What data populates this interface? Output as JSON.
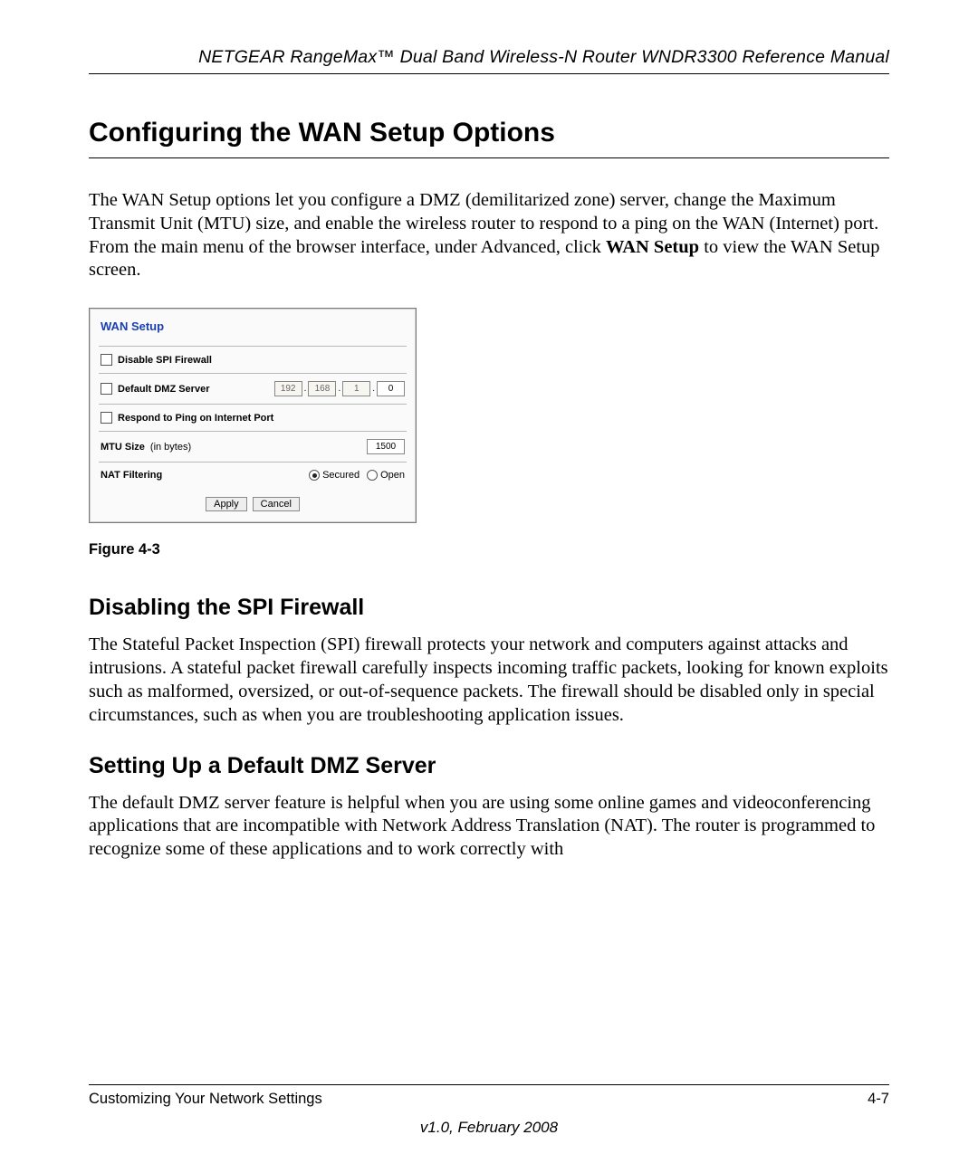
{
  "header": {
    "running": "NETGEAR RangeMax™ Dual Band Wireless-N Router WNDR3300 Reference Manual"
  },
  "section": {
    "title": "Configuring the WAN Setup Options",
    "intro_parts": {
      "p1": "The WAN Setup options let you configure a DMZ (demilitarized zone) server, change the Maximum Transmit Unit (MTU) size, and enable the wireless router to respond to a ping on the WAN (Internet) port. From the main menu of the browser interface, under Advanced, click ",
      "bold": "WAN Setup",
      "p2": " to view the WAN Setup screen."
    }
  },
  "panel": {
    "title": "WAN Setup",
    "rows": {
      "spi_label": "Disable SPI Firewall",
      "dmz_label": "Default DMZ Server",
      "dmz_ip": {
        "a": "192",
        "b": "168",
        "c": "1",
        "d": "0"
      },
      "ping_label": "Respond to Ping on Internet Port",
      "mtu_label": "MTU Size",
      "mtu_sub": "(in bytes)",
      "mtu_value": "1500",
      "nat_label": "NAT Filtering",
      "nat_opts": {
        "secured": "Secured",
        "open": "Open"
      }
    },
    "buttons": {
      "apply": "Apply",
      "cancel": "Cancel"
    }
  },
  "figure_caption": "Figure 4-3",
  "sub_sections": {
    "spi": {
      "title": "Disabling the SPI Firewall",
      "body": "The Stateful Packet Inspection (SPI) firewall protects your network and computers against attacks and intrusions. A stateful packet firewall carefully inspects incoming traffic packets, looking for known exploits such as malformed, oversized, or out-of-sequence packets. The firewall should be disabled only in special circumstances, such as when you are troubleshooting application issues."
    },
    "dmz": {
      "title": "Setting Up a Default DMZ Server",
      "body": "The default DMZ server feature is helpful when you are using some online games and videoconferencing applications that are incompatible with Network Address Translation (NAT). The router is programmed to recognize some of these applications and to work correctly with"
    }
  },
  "footer": {
    "left": "Customizing Your Network Settings",
    "right": "4-7",
    "version": "v1.0, February 2008"
  }
}
